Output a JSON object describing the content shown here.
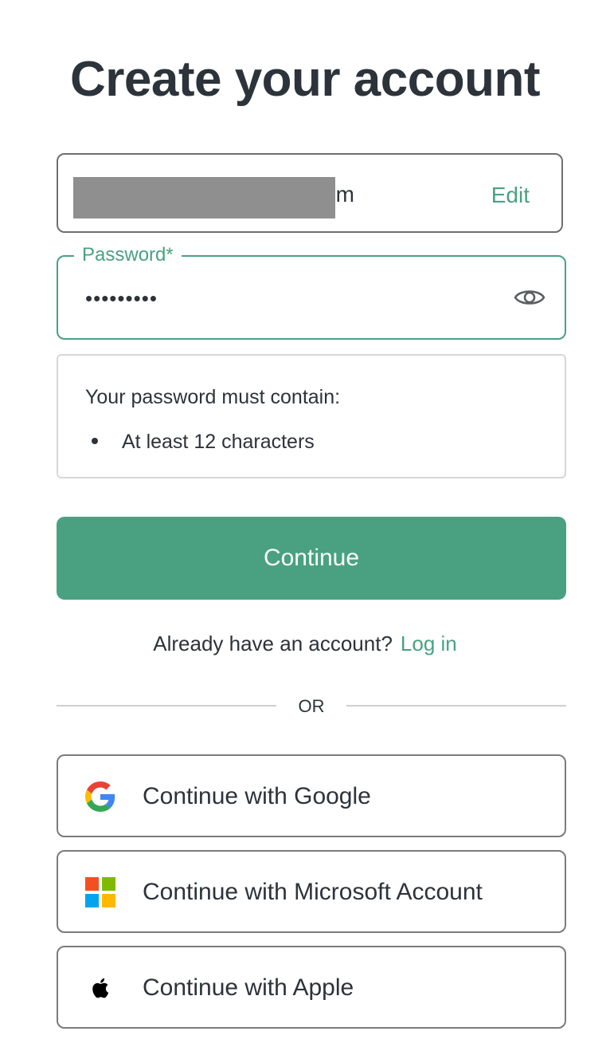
{
  "header": {
    "title": "Create your account"
  },
  "email": {
    "value_visible_suffix": "om",
    "edit_label": "Edit"
  },
  "password": {
    "label": "Password*",
    "value_masked": "•••••••••"
  },
  "requirements": {
    "title": "Your password must contain:",
    "items": [
      {
        "text": "At least 12 characters"
      }
    ]
  },
  "actions": {
    "continue_label": "Continue"
  },
  "login": {
    "prompt_text": "Already have an account?",
    "link_label": "Log in"
  },
  "divider": {
    "text": "OR"
  },
  "social": {
    "google_label": "Continue with Google",
    "microsoft_label": "Continue with Microsoft Account",
    "apple_label": "Continue with Apple"
  },
  "colors": {
    "accent": "#4aa181",
    "text": "#2d333a",
    "border_default": "#6f6f6f",
    "border_focus": "#4aa181",
    "border_light": "#d7d7d7"
  },
  "icons": {
    "google": "google-icon",
    "microsoft": "microsoft-icon",
    "apple": "apple-icon",
    "password_visibility": "eye-icon"
  }
}
